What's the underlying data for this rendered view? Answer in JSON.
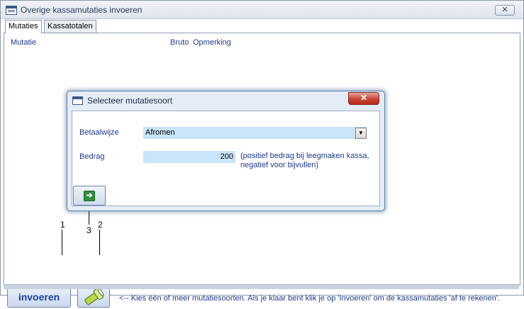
{
  "window": {
    "title": "Overige kassamutaties invoeren",
    "close_symbol": "✕"
  },
  "tabs": [
    {
      "label": "Mutaties",
      "active": true
    },
    {
      "label": "Kassatotalen",
      "active": false
    }
  ],
  "list_headers": {
    "mutatie": "Mutatie",
    "bruto": "Bruto",
    "opmerking": "Opmerking"
  },
  "dialog": {
    "title": "Selecteer mutatiesoort",
    "close_symbol": "✕",
    "betaalwijze_label": "Betaalwijze",
    "betaalwijze_value": "Afromen",
    "bedrag_label": "Bedrag",
    "bedrag_value": "200",
    "bedrag_note": "(positief bedrag bij leegmaken kassa, negatief voor bijvullen)",
    "next_icon": "arrow-right-icon"
  },
  "bottom": {
    "invoeren_label": "invoeren",
    "clear_icon": "flashlight-clear-icon",
    "hint": "<-- Kies één of meer mutatiesoorten. Als je klaar bent klik je op 'Invoeren' om de kassamutaties 'af te rekenen'."
  },
  "callouts": {
    "one": "1",
    "two": "2",
    "three": "3"
  },
  "colors": {
    "label_blue": "#1f3b8a",
    "field_blue": "#c9e3f8",
    "close_red": "#c74333"
  }
}
